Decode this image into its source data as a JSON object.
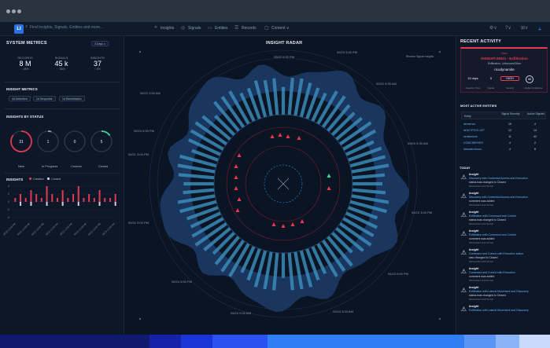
{
  "nav": {
    "logo": "LI",
    "search_placeholder": "Find Insights, Signals, Entities and more...",
    "items": [
      "Insights",
      "Signals",
      "Entities",
      "Records",
      "Content ∨"
    ]
  },
  "system_metrics": {
    "title": "SYSTEM METRICS",
    "range": "3 Days ∨",
    "metrics": [
      {
        "label": "RECORDS",
        "value": "8 M",
        "pct": "↑ 85%"
      },
      {
        "label": "SIGNALS",
        "value": "45 k",
        "pct": "↑ 88%"
      },
      {
        "label": "INSIGHTS",
        "value": "37",
        "pct": "↑ 8%"
      }
    ]
  },
  "insight_metrics": {
    "title": "INSIGHT METRICS",
    "buttons": [
      "4d Detection",
      "1d Response",
      "1d Remediation"
    ]
  },
  "insights_by_status": {
    "title": "INSIGHTS BY STATUS",
    "rings": [
      {
        "value": "31",
        "label": "New",
        "color": "#e23a4f",
        "fraction": 0.85
      },
      {
        "value": "1",
        "label": "In Progress",
        "color": "#9aa3b2",
        "fraction": 0.05
      },
      {
        "value": "0",
        "label": "Custom",
        "color": "#9aa3b2",
        "fraction": 0.0
      },
      {
        "value": "5",
        "label": "Closed",
        "color": "#3fd6a0",
        "fraction": 0.15
      }
    ]
  },
  "insights_chart": {
    "title": "INSIGHTS",
    "legend_created": "Created",
    "legend_closed": "Closed"
  },
  "chart_data": {
    "type": "bar",
    "yticks": [
      "4",
      "2",
      "0",
      "-2",
      "-4"
    ],
    "categories": [
      "09/20 12:00 PM",
      "09/21 12:00 AM",
      "09/21 12:00 PM",
      "09/22 12:00 AM",
      "09/22 12:00 PM",
      "09/23 12:00 AM",
      "09/23 12:00 PM",
      "09/24 12:00 AM"
    ],
    "series": [
      {
        "name": "Created",
        "color": "#e23a4f",
        "values": [
          1,
          2,
          1,
          3,
          2,
          1,
          4,
          2,
          1,
          3,
          1,
          2,
          4,
          1,
          2,
          1,
          3,
          1,
          1,
          2
        ]
      },
      {
        "name": "Closed",
        "color": "#c9d3e3",
        "values": [
          0,
          1,
          0,
          1,
          0,
          0,
          1,
          0,
          0,
          1,
          0,
          0,
          1,
          0,
          0,
          0,
          1,
          0,
          0,
          1
        ]
      }
    ],
    "ylim": [
      -4,
      4
    ]
  },
  "radar": {
    "title": "INSIGHT RADAR",
    "legend": [
      "Records",
      "Signals",
      "Insights"
    ],
    "time_labels": [
      "09/23 3:00 PM",
      "09/22 9:00 PM",
      "09/22 3:00 AM",
      "09/22 9:00 AM",
      "09/21 3:00 PM",
      "09/21 9:00 PM",
      "09/23 9:00 AM",
      "09/23 3:00 PM",
      "09/23 9:00 PM",
      "09/24 3:00 AM",
      "09/24 9:00 AM",
      "09/24 3:00 PM",
      "09/24 9:00 PM"
    ]
  },
  "recent_activity": {
    "title": "RECENT ACTIVITY",
    "card": {
      "tag": "New",
      "id": "INSIGHT-26021 - Exfiltration",
      "sub": "Exfiltration, Unknown/Other",
      "entity": "ricodynamite",
      "stats": [
        {
          "value": "15 days",
          "label": "Detection Time"
        },
        {
          "value": "5",
          "label": "Signals"
        },
        {
          "value": "HIGH",
          "label": "Severity"
        },
        {
          "value": "96",
          "label": "Global Confidence"
        }
      ]
    },
    "entities_title": "MOST ACTIVE ENTITIES",
    "entity_headers": [
      "Entity",
      "Signal Severity",
      "Active Signals"
    ],
    "entities": [
      {
        "name": "devserver",
        "sev": "15",
        "sig": "4"
      },
      {
        "name": "W10CPYDG-327",
        "sev": "12",
        "sig": "14"
      },
      {
        "name": "sentinelone",
        "sev": "11",
        "sig": "42"
      },
      {
        "name": "COMCSERVER",
        "sev": "4",
        "sig": "2"
      },
      {
        "name": "ldmodernfocus",
        "sev": "4",
        "sig": "8"
      }
    ],
    "today": "TODAY",
    "feed": [
      {
        "title": "Insight",
        "sub": "Discovery with Credential Access and Execution",
        "sub2": "status was changed to Closed",
        "time": "09/24/2023 9:02:38 AM"
      },
      {
        "title": "Insight",
        "sub": "Discovery with Credential Access and Execution",
        "sub2": "comment was added",
        "time": "09/24/2023 9:02:35 AM"
      },
      {
        "title": "Insight",
        "sub": "Exfiltration with Command and Control",
        "sub2": "status was changed to Closed",
        "time": "09/24/2023 9:01:09 AM"
      },
      {
        "title": "Insight",
        "sub": "Exfiltration with Command and Control",
        "sub2": "comment was added",
        "time": "09/24/2023 9:01:05 AM"
      },
      {
        "title": "Insight",
        "sub": "Command and Control with Execution status",
        "sub2": "was changed to Closed",
        "time": "09/24/2023 8:59:58 AM"
      },
      {
        "title": "Insight",
        "sub": "Command and Control with Execution",
        "sub2": "comment was added",
        "time": "09/24/2023 8:59:55 AM"
      },
      {
        "title": "Insight",
        "sub": "Exfiltration with Lateral Movement and Discovery",
        "sub2": "status was changed to Closed",
        "time": "09/24/2023 8:58:39 AM"
      },
      {
        "title": "Insight",
        "sub": "Exfiltration with Lateral Movement and Discovery",
        "sub2": "",
        "time": ""
      }
    ]
  }
}
